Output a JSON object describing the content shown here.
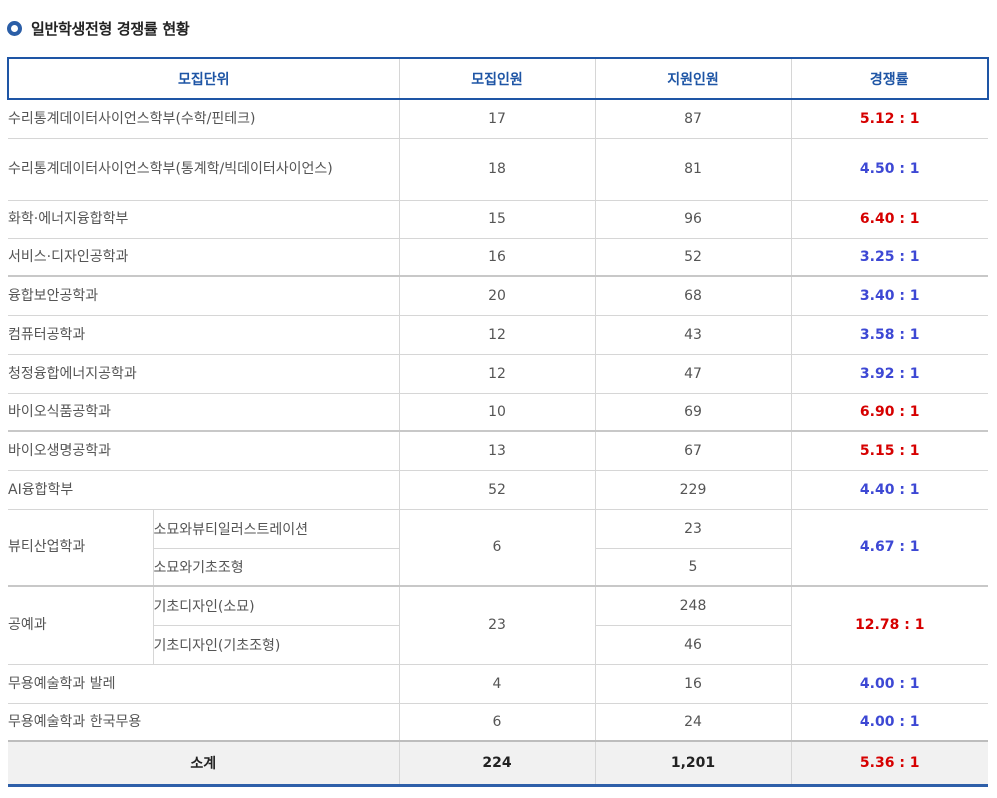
{
  "heading": {
    "title": "일반학생전형 경쟁률 현황"
  },
  "colors": {
    "accent": "#1e55a5",
    "high_rate": "#d60000",
    "low_rate": "#3d48d4"
  },
  "table": {
    "headers": [
      "모집단위",
      "모집인원",
      "지원인원",
      "경쟁률"
    ],
    "rows": [
      {
        "unit": "수리통계데이터사이언스학부(수학/핀테크)",
        "quota": "17",
        "applicants": "87",
        "rate": "5.12 : 1",
        "rate_level": "high"
      },
      {
        "unit": "수리통계데이터사이언스학부(통계학/빅데이터사이언스)",
        "quota": "18",
        "applicants": "81",
        "rate": "4.50 : 1",
        "rate_level": "low"
      },
      {
        "unit": "화학·에너지융합학부",
        "quota": "15",
        "applicants": "96",
        "rate": "6.40 : 1",
        "rate_level": "high"
      },
      {
        "unit": "서비스·디자인공학과",
        "quota": "16",
        "applicants": "52",
        "rate": "3.25 : 1",
        "rate_level": "low"
      },
      {
        "unit": "융합보안공학과",
        "quota": "20",
        "applicants": "68",
        "rate": "3.40 : 1",
        "rate_level": "low"
      },
      {
        "unit": "컴퓨터공학과",
        "quota": "12",
        "applicants": "43",
        "rate": "3.58 : 1",
        "rate_level": "low"
      },
      {
        "unit": "청정융합에너지공학과",
        "quota": "12",
        "applicants": "47",
        "rate": "3.92 : 1",
        "rate_level": "low"
      },
      {
        "unit": "바이오식품공학과",
        "quota": "10",
        "applicants": "69",
        "rate": "6.90 : 1",
        "rate_level": "high"
      },
      {
        "unit": "바이오생명공학과",
        "quota": "13",
        "applicants": "67",
        "rate": "5.15 : 1",
        "rate_level": "high"
      },
      {
        "unit": "AI융합학부",
        "quota": "52",
        "applicants": "229",
        "rate": "4.40 : 1",
        "rate_level": "low"
      },
      {
        "unit": "무용예술학과 발레",
        "quota": "4",
        "applicants": "16",
        "rate": "4.00 : 1",
        "rate_level": "low"
      },
      {
        "unit": "무용예술학과 한국무용",
        "quota": "6",
        "applicants": "24",
        "rate": "4.00 : 1",
        "rate_level": "low"
      }
    ],
    "beauty": {
      "unit": "뷰티산업학과",
      "quota": "6",
      "rate": "4.67 : 1",
      "rate_level": "low",
      "subs": [
        {
          "name": "소묘와뷰티일러스트레이션",
          "applicants": "23"
        },
        {
          "name": "소묘와기초조형",
          "applicants": "5"
        }
      ]
    },
    "craft": {
      "unit": "공예과",
      "quota": "23",
      "rate": "12.78 : 1",
      "rate_level": "high",
      "subs": [
        {
          "name": "기초디자인(소묘)",
          "applicants": "248"
        },
        {
          "name": "기초디자인(기초조형)",
          "applicants": "46"
        }
      ]
    },
    "total": {
      "label": "소계",
      "quota": "224",
      "applicants": "1,201",
      "rate": "5.36 : 1",
      "rate_level": "high"
    }
  }
}
